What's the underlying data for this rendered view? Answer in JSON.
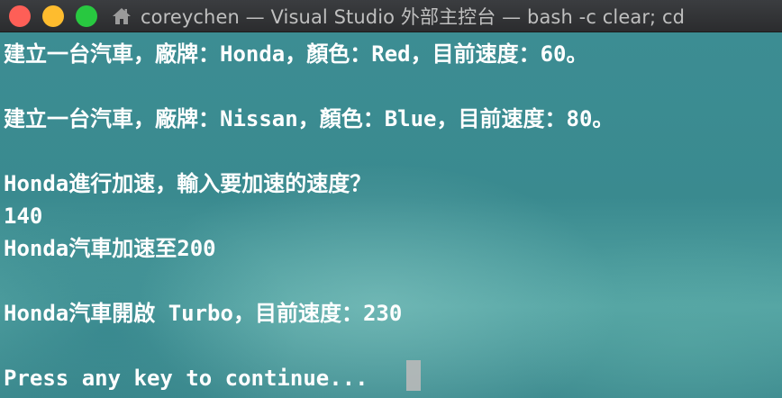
{
  "window": {
    "title": "coreychen — Visual Studio 外部主控台 — bash -c clear; cd",
    "buttons": {
      "close": "close-button",
      "minimize": "minimize-button",
      "zoom": "zoom-button"
    },
    "colors": {
      "close": "#fe5f57",
      "minimize": "#febc2e",
      "zoom": "#28c840",
      "title_bar": "#2b2c2e",
      "terminal_bg": "#3f8f93",
      "text": "#ffffff"
    }
  },
  "terminal": {
    "lines": [
      "建立一台汽車，廠牌：Honda，顏色：Red，目前速度：60。",
      "",
      "建立一台汽車，廠牌：Nissan，顏色：Blue，目前速度：80。",
      "",
      "Honda進行加速，輸入要加速的速度？",
      "140",
      "Honda汽車加速至200",
      "",
      "Honda汽車開啟 Turbo，目前速度：230",
      "",
      "Press any key to continue..."
    ]
  }
}
